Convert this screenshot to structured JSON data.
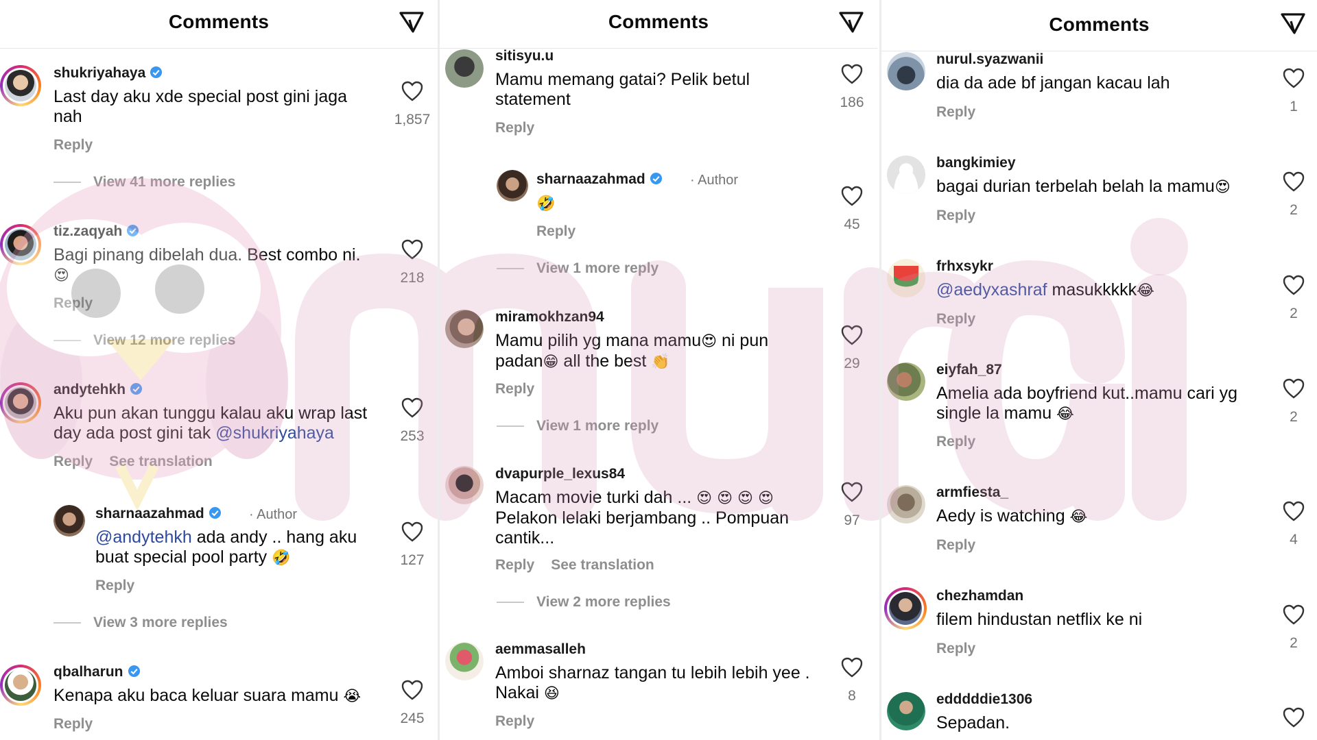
{
  "panels": [
    {
      "title": "Comments",
      "comments": [
        {
          "username": "shukriyahaya",
          "verified": true,
          "text": "Last day aku xde special post gini jaga nah",
          "likes": "1,857",
          "reply": "Reply",
          "view_replies": "View 41 more replies"
        },
        {
          "username": "tiz.zaqyah",
          "verified": true,
          "text": "Bagi pinang dibelah dua. Best combo ni.",
          "emoji": "😍",
          "likes": "218",
          "reply": "Reply",
          "view_replies": "View 12 more replies"
        },
        {
          "username": "andytehkh",
          "verified": true,
          "text": "Aku pun akan tunggu kalau aku wrap last day ada post gini tak",
          "mention": "@shukriyahaya",
          "likes": "253",
          "reply": "Reply",
          "see_translation": "See translation"
        },
        {
          "username": "sharnaazahmad",
          "verified": true,
          "author": "· Author",
          "mention": "@andytehkh",
          "text": "ada andy .. hang aku buat special pool party",
          "emoji": "🤣",
          "likes": "127",
          "reply": "Reply",
          "view_replies": "View 3 more replies"
        },
        {
          "username": "qbalharun",
          "verified": true,
          "text": "Kenapa aku baca keluar suara mamu",
          "emoji": "😭",
          "likes": "245",
          "reply": "Reply"
        }
      ]
    },
    {
      "title": "Comments",
      "comments": [
        {
          "username": "sitisyu.u",
          "text": "Mamu memang gatai? Pelik betul statement",
          "likes": "186",
          "reply": "Reply"
        },
        {
          "username": "sharnaazahmad",
          "verified": true,
          "author": "· Author",
          "emoji": "🤣",
          "likes": "45",
          "reply": "Reply",
          "view_replies": "View 1 more reply"
        },
        {
          "username": "miramokhzan94",
          "text_a": "Mamu pilih yg mana mamu",
          "emoji_a": "😍",
          "text_b": "ni pun padan",
          "emoji_b": "😁",
          "text_c": "all the best",
          "emoji_c": "👏",
          "likes": "29",
          "reply": "Reply",
          "view_replies": "View 1 more reply"
        },
        {
          "username": "dvapurple_lexus84",
          "text": "Macam movie turki dah ...",
          "emoji": "😍 😍 😍 😍",
          "text2": "Pelakon lelaki berjambang .. Pompuan cantik...",
          "likes": "97",
          "reply": "Reply",
          "see_translation": "See translation",
          "view_replies": "View 2 more replies"
        },
        {
          "username": "aemmasalleh",
          "text": "Amboi sharnaz tangan tu lebih lebih yee . Nakai",
          "emoji": "😆",
          "likes": "8",
          "reply": "Reply"
        }
      ]
    },
    {
      "title": "Comments",
      "comments": [
        {
          "username": "nurul.syazwanii",
          "text": "dia da ade bf jangan kacau lah",
          "likes": "1",
          "reply": "Reply"
        },
        {
          "username": "bangkimiey",
          "text": "bagai durian terbelah belah la mamu",
          "emoji": "😍",
          "likes": "2",
          "reply": "Reply"
        },
        {
          "username": "frhxsykr",
          "mention": "@aedyxashraf",
          "text": "masukkkkk",
          "emoji": "😂",
          "likes": "2",
          "reply": "Reply"
        },
        {
          "username": "eiyfah_87",
          "text": "Amelia ada boyfriend kut..mamu cari yg single la mamu",
          "emoji": "😂",
          "likes": "2",
          "reply": "Reply"
        },
        {
          "username": "armfiesta_",
          "text": "Aedy is watching",
          "emoji": "😂",
          "likes": "4",
          "reply": "Reply"
        },
        {
          "username": "chezhamdan",
          "text": "filem hindustan netflix ke ni",
          "likes": "2",
          "reply": "Reply"
        },
        {
          "username": "edddddie1306",
          "text": "Sepadan."
        }
      ]
    }
  ],
  "watermark": {
    "text": "murai"
  },
  "colors": {
    "verified": "#3897f0",
    "mention": "#2c4a9e",
    "muted": "#8e8e8e",
    "watermark": "#d9a7c0"
  },
  "icons": [
    "filter-icon",
    "heart-icon",
    "verified-icon",
    "avatar"
  ]
}
